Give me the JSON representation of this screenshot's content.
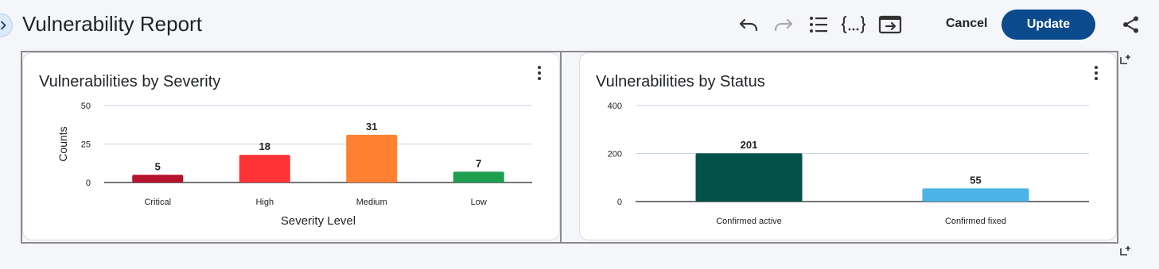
{
  "header": {
    "title": "Vulnerability Report",
    "cancel_label": "Cancel",
    "update_label": "Update"
  },
  "toolbar": {
    "icons": [
      "undo-icon",
      "redo-icon",
      "list-icon",
      "json-braces-icon",
      "export-icon",
      "share-icon"
    ]
  },
  "colors": {
    "update_button": "#0b4a8c",
    "critical": "#b5142a",
    "high": "#ff3336",
    "medium": "#ff8030",
    "low": "#1e9e4f",
    "confirmed_active": "#03524a",
    "confirmed_fixed": "#4cb3e6"
  },
  "panels": [
    {
      "title": "Vulnerabilities by Severity",
      "chart_data": {
        "type": "bar",
        "title": "Vulnerabilities by Severity",
        "categories": [
          "Critical",
          "High",
          "Medium",
          "Low"
        ],
        "values": [
          5,
          18,
          31,
          7
        ],
        "value_labels": [
          "5",
          "18",
          "31",
          "7"
        ],
        "colors": [
          "#b5142a",
          "#ff3336",
          "#ff8030",
          "#1e9e4f"
        ],
        "xlabel": "Severity Level",
        "ylabel": "Counts",
        "ylim": [
          0,
          50
        ],
        "yticks": [
          0,
          25,
          50
        ],
        "ytick_labels": [
          "0",
          "25",
          "50"
        ],
        "grid": true,
        "legend": "none"
      }
    },
    {
      "title": "Vulnerabilities by Status",
      "chart_data": {
        "type": "bar",
        "title": "Vulnerabilities by Status",
        "categories": [
          "Confirmed active",
          "Confirmed fixed"
        ],
        "values": [
          201,
          55
        ],
        "value_labels": [
          "201",
          "55"
        ],
        "colors": [
          "#03524a",
          "#4cb3e6"
        ],
        "xlabel": "",
        "ylabel": "",
        "ylim": [
          0,
          400
        ],
        "yticks": [
          0,
          200,
          400
        ],
        "ytick_labels": [
          "0",
          "200",
          "400"
        ],
        "grid": true,
        "legend": "none"
      }
    }
  ]
}
